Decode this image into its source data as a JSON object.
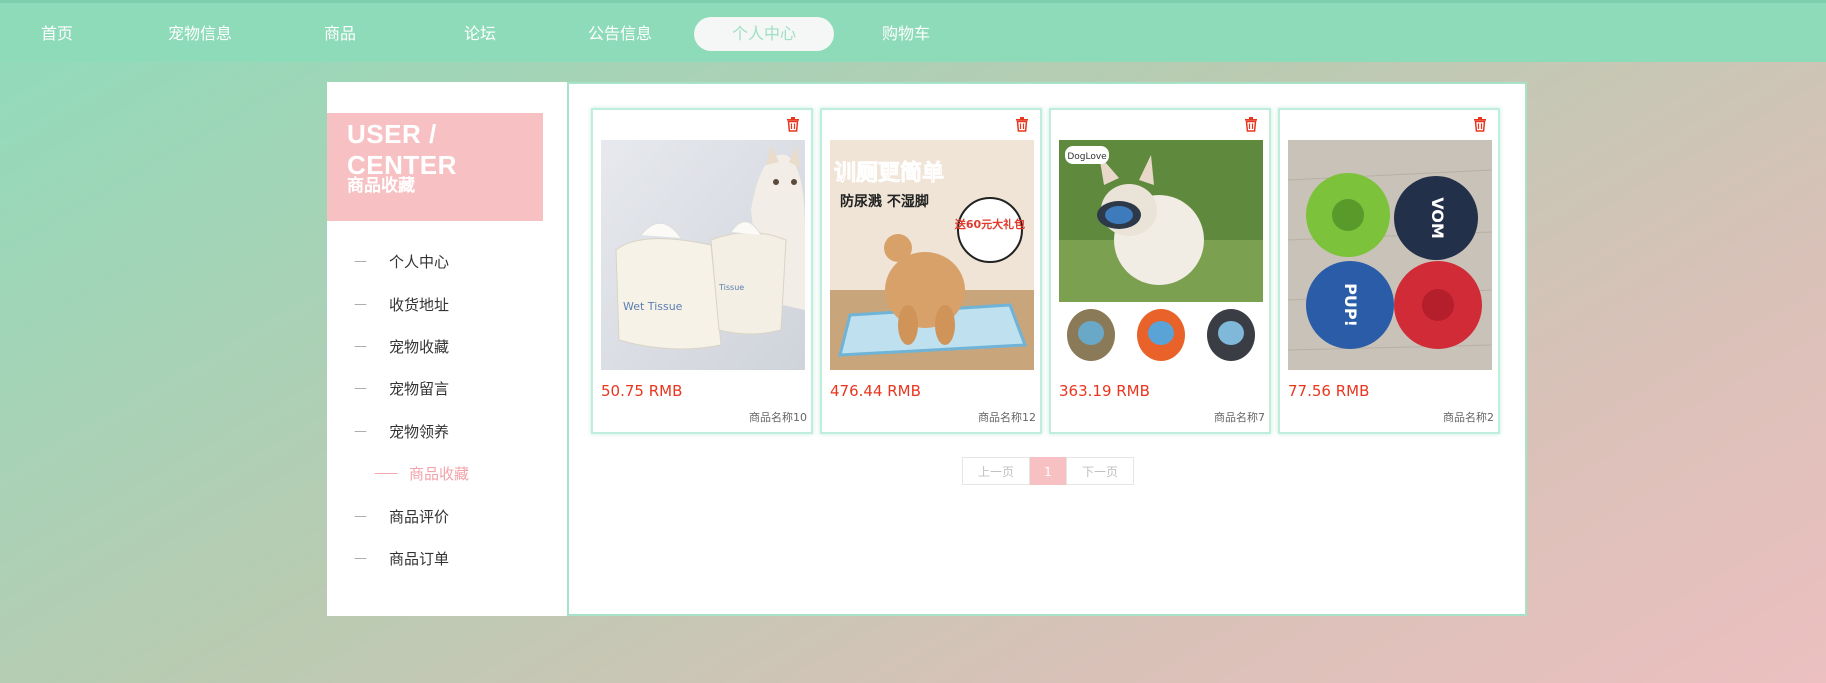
{
  "nav": {
    "items": [
      "首页",
      "宠物信息",
      "商品",
      "论坛",
      "公告信息",
      "个人中心",
      "购物车"
    ],
    "active": "个人中心"
  },
  "sidebar": {
    "title": "USER / CENTER",
    "subtitle": "商品收藏",
    "items": [
      {
        "label": "个人中心",
        "active": false
      },
      {
        "label": "收货地址",
        "active": false
      },
      {
        "label": "宠物收藏",
        "active": false
      },
      {
        "label": "宠物留言",
        "active": false
      },
      {
        "label": "宠物领养",
        "active": false
      },
      {
        "label": "商品收藏",
        "active": true
      },
      {
        "label": "商品评价",
        "active": false
      },
      {
        "label": "商品订单",
        "active": false
      }
    ]
  },
  "products": [
    {
      "price": "50.75 RMB",
      "name": "商品名称10",
      "image": "wet-tissue-cat-photo"
    },
    {
      "price": "476.44 RMB",
      "name": "商品名称12",
      "image": "dog-training-toilet-photo",
      "image_text": {
        "line1": "训厕更简单",
        "line2": "防尿溅 不湿脚",
        "badge": "送60元大礼包"
      }
    },
    {
      "price": "363.19 RMB",
      "name": "商品名称7",
      "image": "dog-muzzle-photo",
      "image_text": {
        "tag": "DogLove"
      }
    },
    {
      "price": "77.56 RMB",
      "name": "商品名称2",
      "image": "pet-bowls-photo",
      "image_text": {
        "a": "PUP!",
        "b": "VOM"
      }
    }
  ],
  "pagination": {
    "prev": "上一页",
    "current": "1",
    "next": "下一页"
  },
  "colors": {
    "primary": "#8ddbb9",
    "accent_pink": "#f7c1c3",
    "price": "#e8361f"
  },
  "icons": {
    "delete": "trash-icon"
  }
}
